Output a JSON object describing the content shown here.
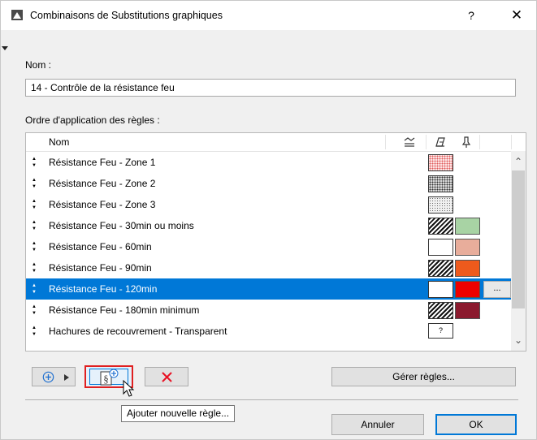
{
  "window": {
    "title": "Combinaisons de Substitutions graphiques",
    "help_label": "?",
    "close_label": "✕"
  },
  "name_field": {
    "label": "Nom :",
    "value": "14 - Contrôle de la résistance feu"
  },
  "rules": {
    "label": "Ordre d'application des règles :",
    "column_name": "Nom",
    "column_icons": [
      "layer-stack-icon",
      "fill-pattern-icon",
      "pen-icon"
    ],
    "items": [
      {
        "name": "Résistance Feu - Zone 1",
        "fill": "dots-pink",
        "bg": ""
      },
      {
        "name": "Résistance Feu - Zone 2",
        "fill": "dots-dark",
        "bg": ""
      },
      {
        "name": "Résistance Feu - Zone 3",
        "fill": "dots-light",
        "bg": ""
      },
      {
        "name": "Résistance Feu - 30min ou moins",
        "fill": "hatch",
        "bg": "#a8d3a4"
      },
      {
        "name": "Résistance Feu - 60min",
        "fill": "white",
        "bg": "#e8ad9b"
      },
      {
        "name": "Résistance Feu - 90min",
        "fill": "hatch",
        "bg": "#ee5a1c"
      },
      {
        "name": "Résistance Feu - 120min",
        "fill": "white",
        "bg": "#ee0000",
        "selected": true,
        "more_label": "..."
      },
      {
        "name": "Résistance Feu - 180min minimum",
        "fill": "hatch",
        "bg": "#8b1a2e"
      },
      {
        "name": "Hachures de recouvrement - Transparent",
        "fill": "question",
        "bg": "",
        "question_label": "?"
      }
    ]
  },
  "buttons": {
    "add_icon": "circle-plus-icon",
    "new_rule_icon": "new-rule-icon",
    "delete_icon": "red-x-icon",
    "manage_label": "Gérer règles...",
    "cancel_label": "Annuler",
    "ok_label": "OK"
  },
  "tooltip": "Ajouter nouvelle règle...",
  "colors": {
    "selection": "#0078d7",
    "highlight_border": "#e02020",
    "delete_red": "#e81123"
  }
}
